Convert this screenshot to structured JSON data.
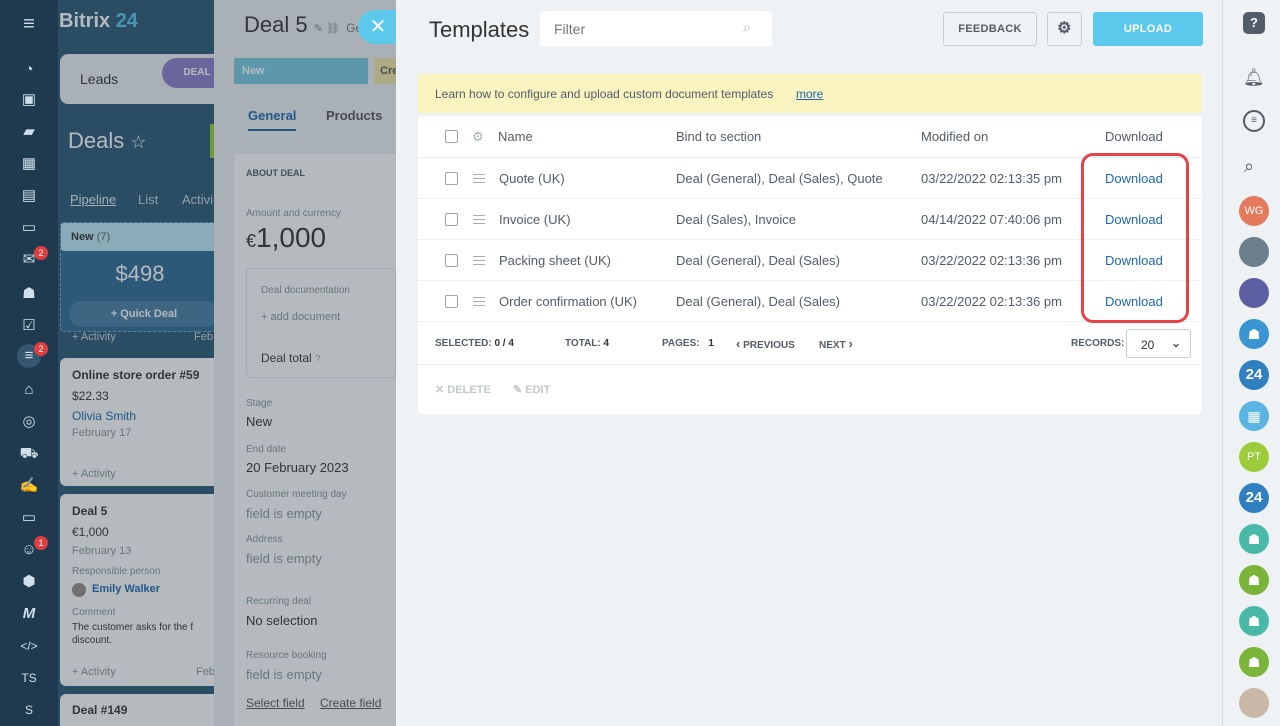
{
  "left_nav": {
    "menu_icon": "menu-icon",
    "badges": [
      "2",
      "2",
      "1"
    ],
    "bottom_labels": [
      "TS",
      "S"
    ]
  },
  "background": {
    "brand": "Bitrix",
    "brand_num": "24",
    "tabs": {
      "leads": "Leads",
      "deal": "DEAL"
    },
    "deals_title": "Deals",
    "view_tabs": [
      "Pipeline",
      "List",
      "Activi"
    ],
    "column": {
      "name": "New",
      "count": "(7)",
      "sum": "$498",
      "quick_deal": "+ Quick Deal",
      "activity": "+ Activity",
      "feb": "Feb"
    },
    "cards": [
      {
        "title": "Online store order #59",
        "amount": "$22.33",
        "person": "Olivia Smith",
        "date": "February 17",
        "activity": "+ Activity"
      },
      {
        "title": "Deal 5",
        "amount": "€1,000",
        "date": "February 13",
        "resp_label": "Responsible person",
        "person": "Emily Walker",
        "comment_label": "Comment",
        "comment": "The customer asks for the f discount.",
        "activity": "+ Activity",
        "feb": "Feb"
      },
      {
        "title": "Deal #149"
      }
    ],
    "deal_form": {
      "title": "Deal 5",
      "gen": "Ger",
      "stage_new": "New",
      "stage_cr": "Cre",
      "tab_general": "General",
      "tab_products": "Products",
      "about": "ABOUT DEAL",
      "amount_label": "Amount and currency",
      "currency": "€",
      "amount": "1,000",
      "doc_label": "Deal documentation",
      "add_doc": "+ add document",
      "deal_total": "Deal total",
      "stage_label": "Stage",
      "stage_value": "New",
      "end_label": "End date",
      "end_value": "20 February 2023",
      "meeting_label": "Customer meeting day",
      "meeting_value": "field is empty",
      "address_label": "Address",
      "address_value": "field is empty",
      "recurring_label": "Recurring deal",
      "recurring_value": "No selection",
      "resource_label": "Resource booking",
      "resource_value": "field is empty",
      "select_field": "Select field",
      "create_field": "Create field"
    }
  },
  "templates": {
    "title": "Templates",
    "filter_placeholder": "Filter",
    "feedback": "FEEDBACK",
    "upload": "UPLOAD",
    "hint": "Learn how to configure and upload custom document templates",
    "hint_more": "more",
    "columns": {
      "name": "Name",
      "section": "Bind to section",
      "modified": "Modified on",
      "download": "Download"
    },
    "rows": [
      {
        "name": "Quote (UK)",
        "section": "Deal (General), Deal (Sales), Quote",
        "modified": "03/22/2022 02:13:35 pm",
        "download": "Download"
      },
      {
        "name": "Invoice (UK)",
        "section": "Deal (Sales), Invoice",
        "modified": "04/14/2022 07:40:06 pm",
        "download": "Download"
      },
      {
        "name": "Packing sheet (UK)",
        "section": "Deal (General), Deal (Sales)",
        "modified": "03/22/2022 02:13:36 pm",
        "download": "Download"
      },
      {
        "name": "Order confirmation (UK)",
        "section": "Deal (General), Deal (Sales)",
        "modified": "03/22/2022 02:13:36 pm",
        "download": "Download"
      }
    ],
    "footer": {
      "selected_label": "SELECTED:",
      "selected_value": "0 / 4",
      "total_label": "TOTAL:",
      "total_value": "4",
      "pages_label": "PAGES:",
      "pages_value": "1",
      "previous": "PREVIOUS",
      "next": "NEXT",
      "records_label": "RECORDS:",
      "records_value": "20"
    },
    "actions": {
      "delete": "DELETE",
      "edit": "EDIT"
    }
  },
  "right_bar": {
    "avatars": [
      "WG",
      "PT",
      "24",
      "24"
    ]
  },
  "colors": {
    "accent": "#5bc8ec",
    "highlight": "#e4434a",
    "link": "#2067b0"
  }
}
